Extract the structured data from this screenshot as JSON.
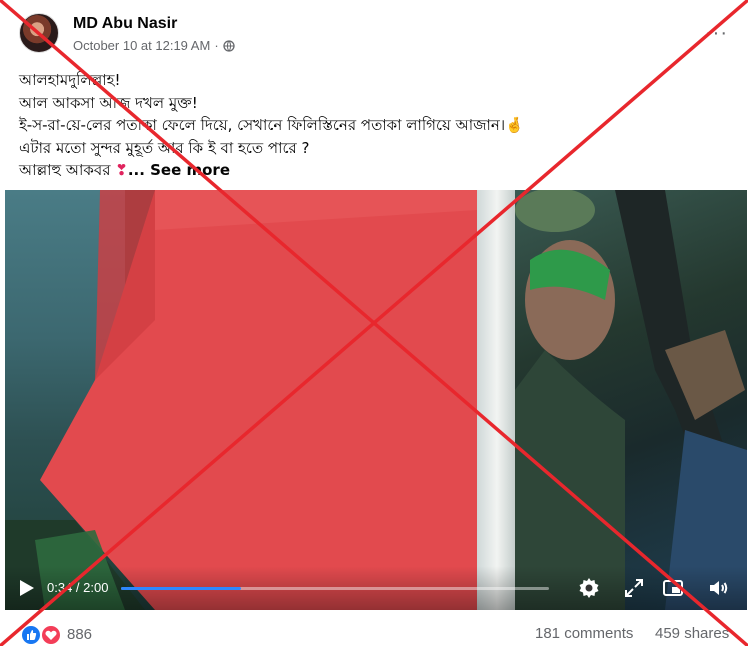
{
  "post": {
    "author": "MD Abu Nasir",
    "timestamp": "October 10 at 12:19 AM",
    "separator": "·",
    "privacy_icon": "globe-icon",
    "menu_icon": "more-options-icon",
    "menu_label": "···",
    "text_lines": [
      "আলহামদুলিল্লাহ!",
      "আল আকসা আজ দখল মুক্ত!",
      "ই-স-রা-য়ে-লের পতাকা ফেলে দিয়ে, সেখানে ফিলিস্তিনের পতাকা লাগিয়ে আজান।",
      "এটার মতো সুন্দর মুহূর্ত আর কি ই বা হতে পারে ?",
      "আল্লাহু আকবর"
    ],
    "pointing_emoji": "🤞",
    "heart_emoji": "❣",
    "see_more": "... See more"
  },
  "video": {
    "time": "0:34 / 2:00",
    "progress": 0.28,
    "controls": [
      "play-icon",
      "settings-gear-icon",
      "fullscreen-expand-icon",
      "picture-in-picture-icon",
      "volume-icon"
    ]
  },
  "footer": {
    "reactions": [
      "like-reaction-icon",
      "love-reaction-icon"
    ],
    "reaction_count": "886",
    "comments": "181 comments",
    "shares": "459 shares"
  },
  "overlay": {
    "type": "red-cross-false-marker",
    "color": "#e8272d"
  }
}
